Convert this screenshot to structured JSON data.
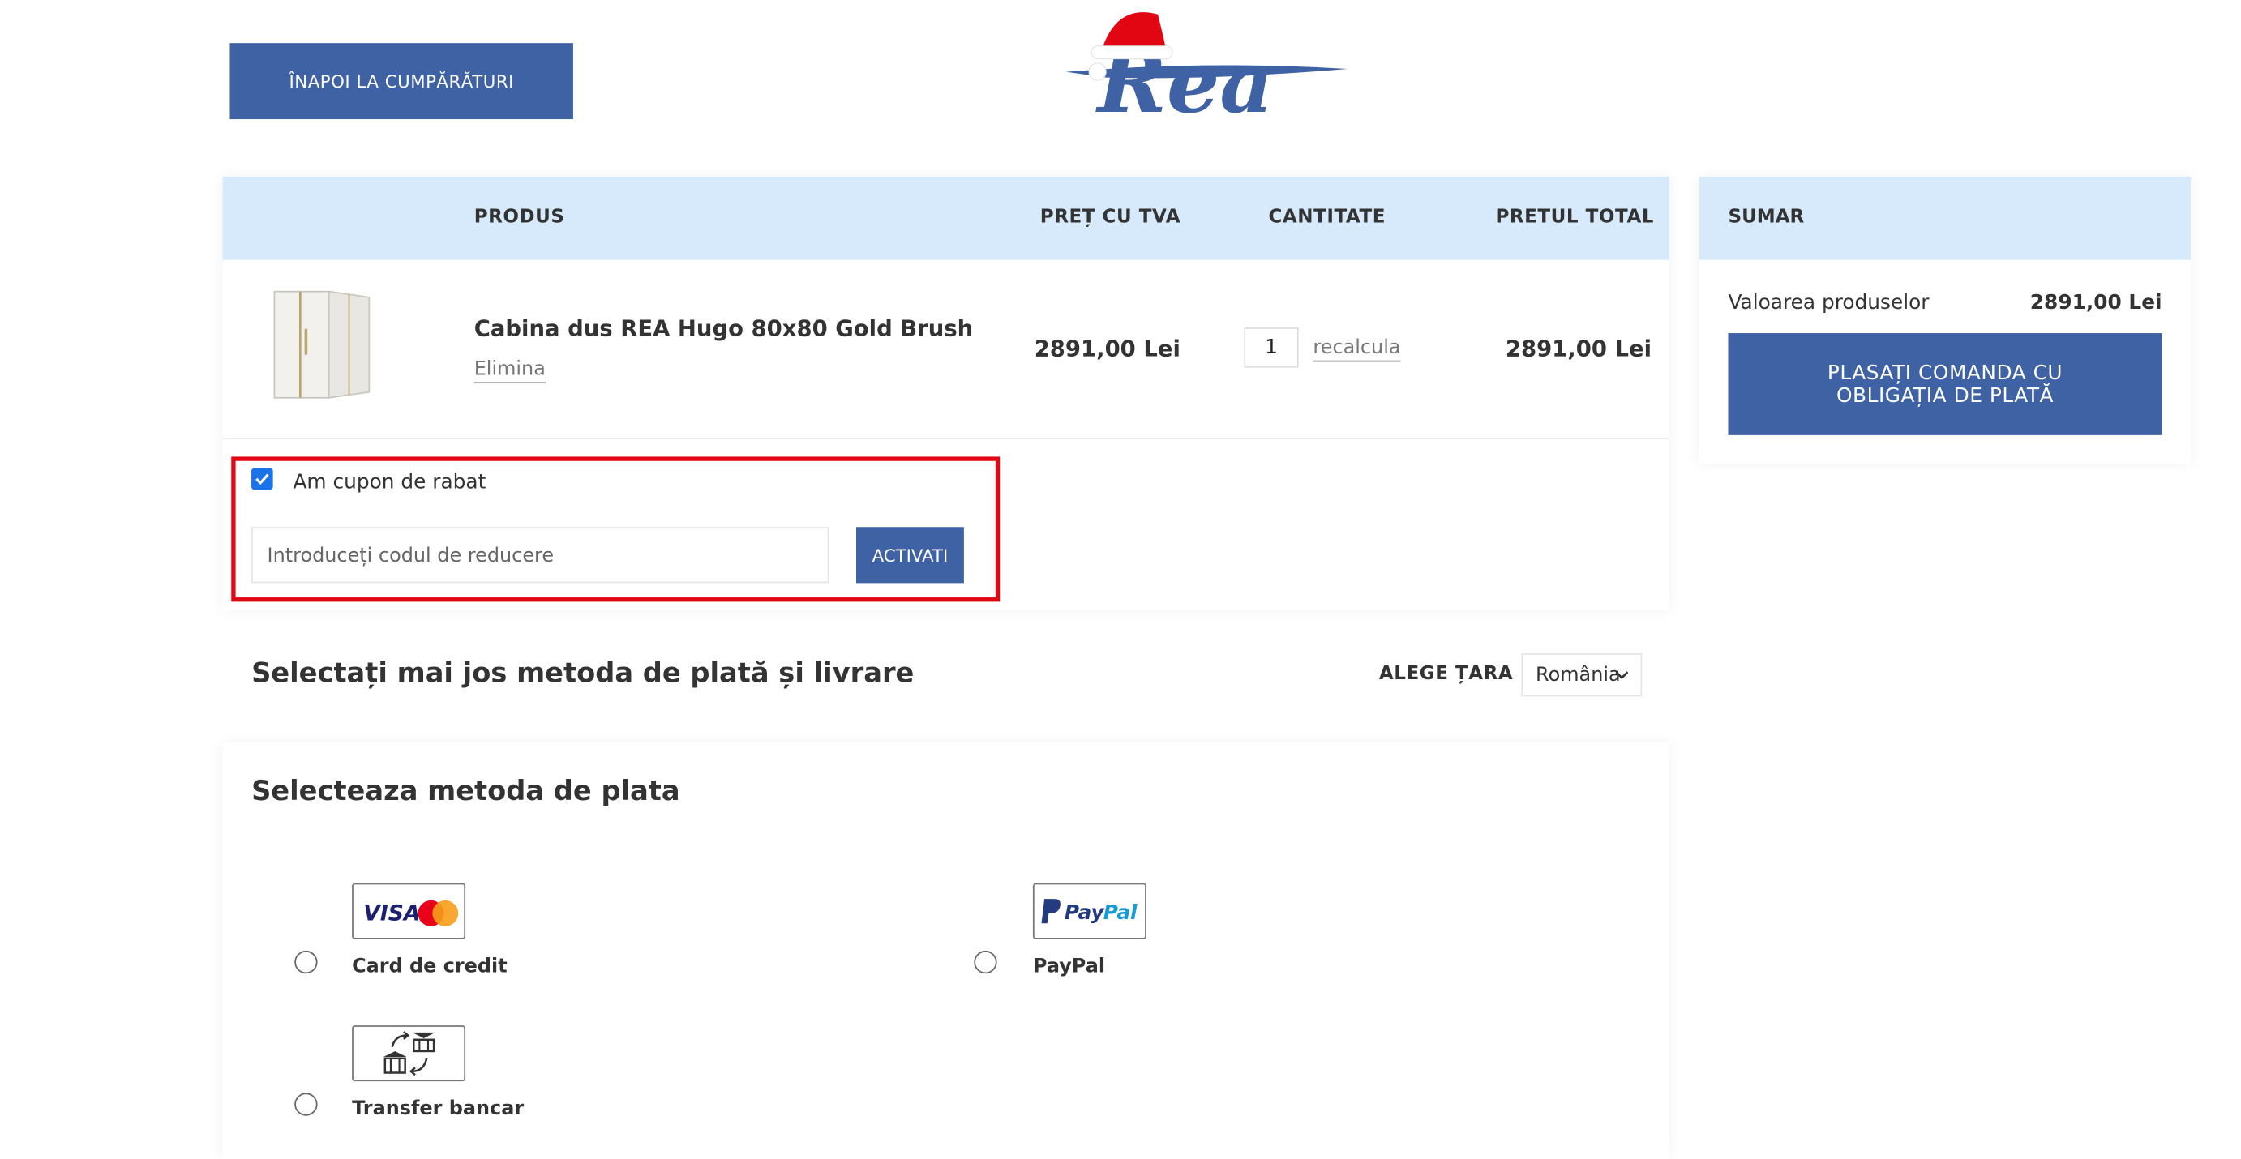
{
  "header": {
    "back_label": "ÎNAPOI LA CUMPĂRĂTURI",
    "logo_text": "Rea"
  },
  "cart": {
    "columns": {
      "product": "PRODUS",
      "price": "PREȚ CU TVA",
      "quantity": "CANTITATE",
      "total": "PRETUL TOTAL"
    },
    "item": {
      "name": "Cabina dus REA Hugo 80x80 Gold Brush",
      "remove_label": "Elimina",
      "price": "2891,00 Lei",
      "quantity": "1",
      "recalc_label": "recalcula",
      "total": "2891,00 Lei"
    },
    "coupon": {
      "checked": true,
      "label": "Am cupon de rabat",
      "placeholder": "Introduceți codul de reducere",
      "button_label": "ACTIVATI"
    }
  },
  "summary": {
    "title": "SUMAR",
    "products_label": "Valoarea produselor",
    "products_value": "2891,00 Lei",
    "order_button": "PLASAȚI COMANDA CU OBLIGAȚIA DE PLATĂ"
  },
  "shipping": {
    "title": "Selectați mai jos metoda de plată și livrare",
    "country_label": "ALEGE ȚARA",
    "country_value": "România"
  },
  "payment": {
    "title": "Selecteaza metoda de plata",
    "methods": [
      {
        "label": "Card de credit",
        "icon": "visa-mastercard-icon"
      },
      {
        "label": "PayPal",
        "icon": "paypal-icon"
      },
      {
        "label": "Transfer bancar",
        "icon": "bank-transfer-icon"
      }
    ]
  },
  "colors": {
    "accent": "#3e62a4",
    "header_band": "#d6eafc",
    "highlight": "#e20613"
  }
}
